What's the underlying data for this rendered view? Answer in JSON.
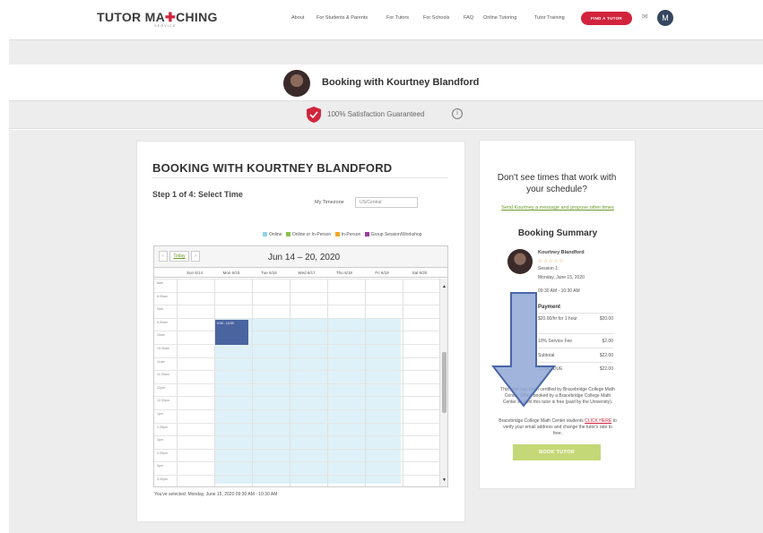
{
  "logo": {
    "part1": "TUTOR MA",
    "part2": "CHING",
    "sub": "SERVICE"
  },
  "nav": {
    "items": [
      "About",
      "For Students & Parents",
      "For Tutors",
      "For Schools",
      "FAQ",
      "Online Tutoring",
      "Tutor Training"
    ],
    "find_button": "FIND A TUTOR",
    "mail_icon": "envelope-icon",
    "user_initial": "M"
  },
  "header": {
    "title": "Booking with Kourtney Blandford",
    "guarantee": "100% Satisfaction Guaranteed",
    "info_symbol": "i"
  },
  "booking": {
    "title": "BOOKING WITH KOURTNEY BLANDFORD",
    "step": "Step 1 of 4: Select Time",
    "timezone_label": "My Timezone",
    "timezone_value": "US/Central",
    "legend": [
      {
        "label": "Online",
        "color": "#8fd3ea"
      },
      {
        "label": "Online or In-Person",
        "color": "#8bc34a"
      },
      {
        "label": "In-Person",
        "color": "#f5a623"
      },
      {
        "label": "Group Session/Workshop",
        "color": "#9c3d9c"
      }
    ]
  },
  "calendar": {
    "prev": "‹",
    "today": "Today",
    "next": "›",
    "range": "Jun 14 – 20, 2020",
    "days": [
      "Sun 6/14",
      "Mon 6/15",
      "Tue 6/16",
      "Wed 6/17",
      "Thu 6/18",
      "Fri 6/19",
      "Sat 6/20"
    ],
    "times": [
      "8am",
      "8:30am",
      "9am",
      "9:30am",
      "10am",
      "10:30am",
      "11am",
      "11:30am",
      "12pm",
      "12:30pm",
      "1pm",
      "1:30pm",
      "2pm",
      "2:30pm",
      "3pm",
      "3:30pm"
    ],
    "selected_event": "9:30 - 10:30",
    "selected_text": "You've selected: Monday, June 15, 2020 09:30 AM - 10:30 AM"
  },
  "summary": {
    "question": "Don't see times that work with your schedule?",
    "link": "Send Kourtney a message and propose other times",
    "title": "Booking Summary",
    "tutor_name": "Kourtney Blandford",
    "stars": "☆☆☆☆☆",
    "session": "Session 1:",
    "date": "Monday, June 15, 2020",
    "time": "09:30 AM - 10:30 AM",
    "payment_title": "Payment",
    "payment_rows": [
      {
        "label": "$20.00/hr for 1 hour",
        "value": "$20.00"
      },
      {
        "label": "10% Service Fee",
        "value": "$2.00"
      },
      {
        "label": "Subtotal",
        "value": "$22.00"
      },
      {
        "label": "TOTAL DUE",
        "value": "$22.00"
      }
    ],
    "fine_print": "This tutor has been certified by Bracebridge College Math Center. When booked by a Bracebridge College Math Center student this tutor is free (paid by the University).",
    "fine_print2_a": "Bracebridge College Math Center students",
    "fine_print2_link": "CLICK HERE",
    "fine_print2_b": "to verify your email address and change the tutor's rate to free.",
    "book_button": "BOOK TUTOR"
  }
}
